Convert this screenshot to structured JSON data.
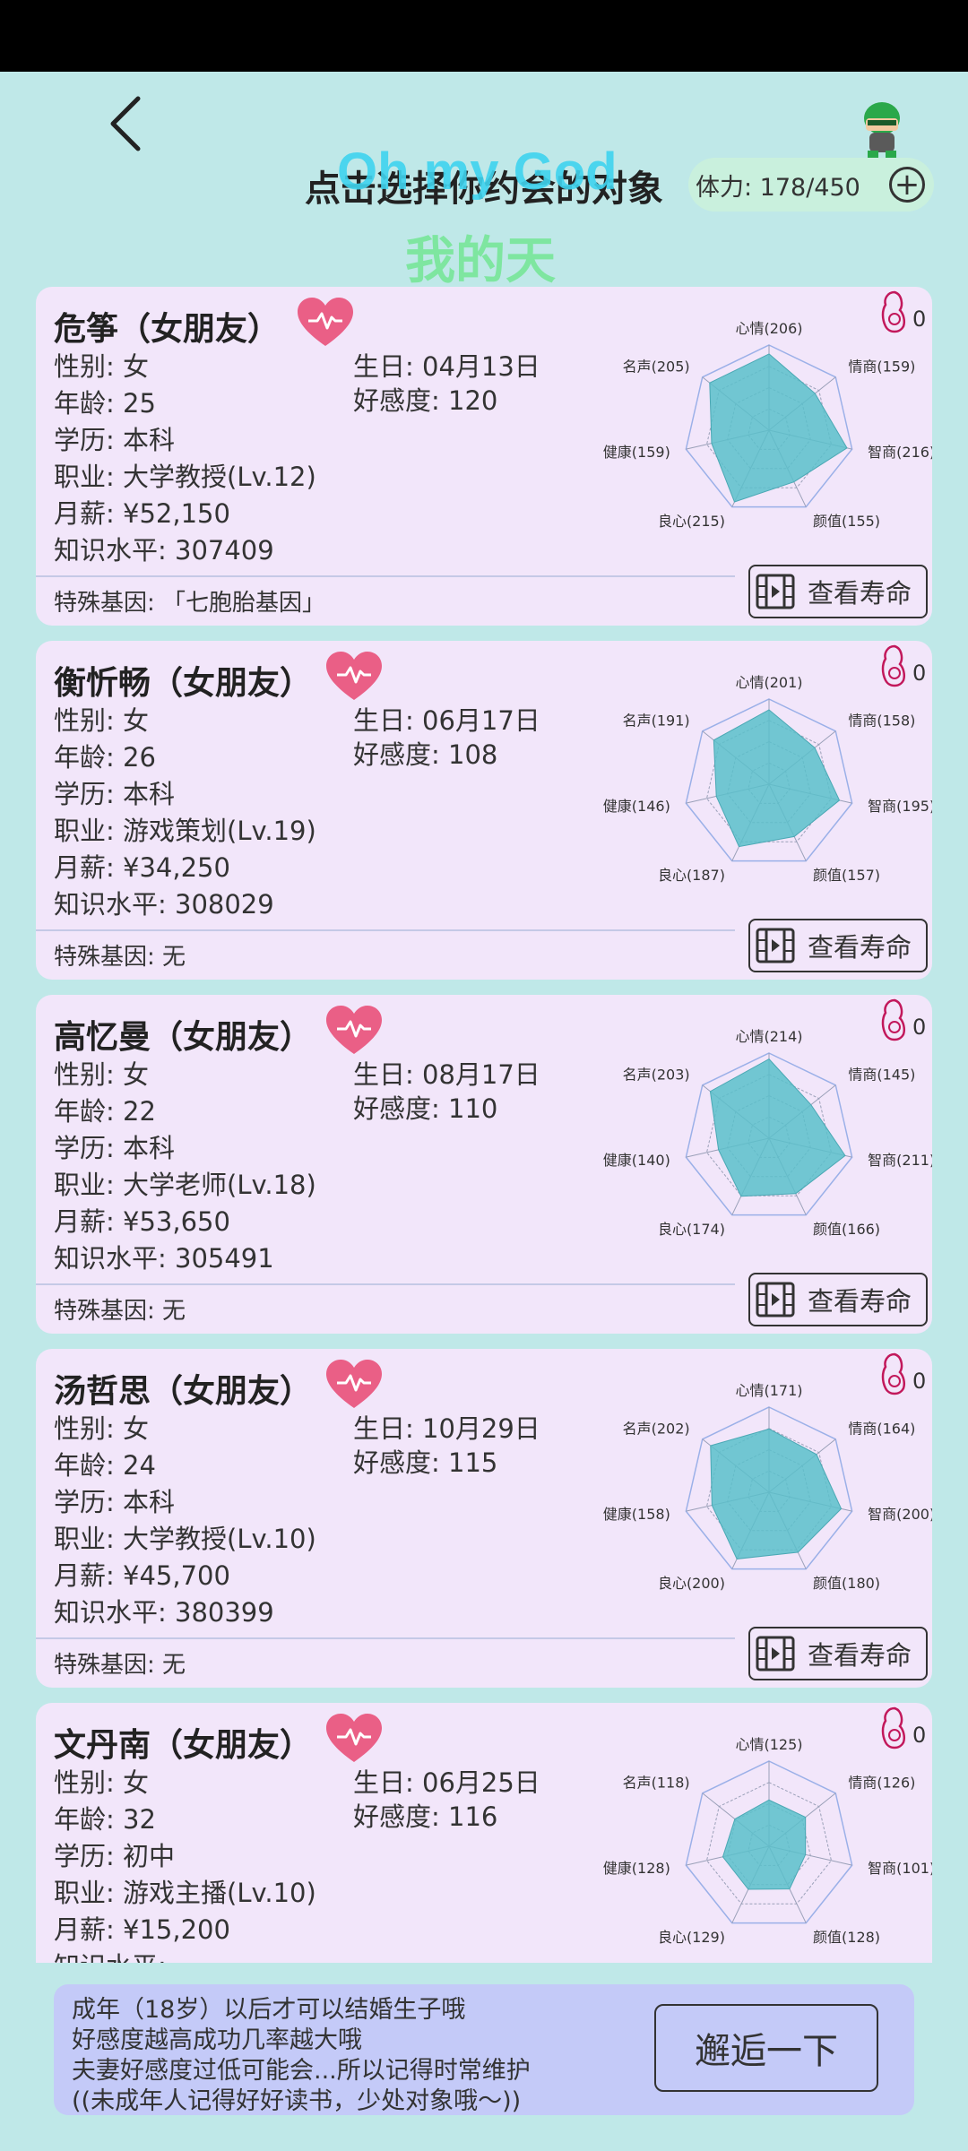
{
  "header": {
    "title": "点击选择你约会的对象",
    "overlay_en": "Oh my God",
    "overlay_zh": "我的天",
    "stamina": "体力: 178/450",
    "plus": "+"
  },
  "labels": {
    "gender": "性别: ",
    "age": "年龄: ",
    "edu": "学历: ",
    "job": "职业: ",
    "salary": "月薪: ",
    "knowledge": "知识水平: ",
    "birthday": "生日: ",
    "affinity": "好感度: ",
    "gene": "特殊基因: ",
    "life_button": "查看寿命",
    "radar_axes": [
      "心情",
      "情商",
      "智商",
      "颜值",
      "良心",
      "健康",
      "名声"
    ]
  },
  "characters": [
    {
      "name": "危筝（女朋友）",
      "gender": "女",
      "age": "25",
      "education": "本科",
      "job": "大学教授(Lv.12)",
      "salary": "¥52,150",
      "knowledge": "307409",
      "birthday": "04月13日",
      "affinity": "120",
      "gene": "「七胞胎基因」",
      "baby_count": "0",
      "stats": [
        206,
        159,
        216,
        155,
        215,
        159,
        205
      ]
    },
    {
      "name": "衡忻畅（女朋友）",
      "gender": "女",
      "age": "26",
      "education": "本科",
      "job": "游戏策划(Lv.19)",
      "salary": "¥34,250",
      "knowledge": "308029",
      "birthday": "06月17日",
      "affinity": "108",
      "gene": "无",
      "baby_count": "0",
      "stats": [
        201,
        158,
        195,
        157,
        187,
        146,
        191
      ]
    },
    {
      "name": "高忆曼（女朋友）",
      "gender": "女",
      "age": "22",
      "education": "本科",
      "job": "大学老师(Lv.18)",
      "salary": "¥53,650",
      "knowledge": "305491",
      "birthday": "08月17日",
      "affinity": "110",
      "gene": "无",
      "baby_count": "0",
      "stats": [
        214,
        145,
        211,
        166,
        174,
        140,
        203
      ]
    },
    {
      "name": "汤哲思（女朋友）",
      "gender": "女",
      "age": "24",
      "education": "本科",
      "job": "大学教授(Lv.10)",
      "salary": "¥45,700",
      "knowledge": "380399",
      "birthday": "10月29日",
      "affinity": "115",
      "gene": "无",
      "baby_count": "0",
      "stats": [
        171,
        164,
        200,
        180,
        200,
        158,
        202
      ]
    },
    {
      "name": "文丹南（女朋友）",
      "gender": "女",
      "age": "32",
      "education": "初中",
      "job": "游戏主播(Lv.10)",
      "salary": "¥15,200",
      "knowledge": "",
      "birthday": "06月25日",
      "affinity": "116",
      "gene": "",
      "baby_count": "0",
      "stats": [
        125,
        126,
        101,
        128,
        129,
        128,
        118
      ]
    }
  ],
  "footer": {
    "tips": [
      "成年（18岁）以后才可以结婚生子哦",
      "好感度越高成功几率越大哦",
      "夫妻好感度过低可能会...所以记得时常维护",
      "((未成年人记得好好读书，少处对象哦～))"
    ],
    "button": "邂逅一下"
  },
  "colors": {
    "background": "#bfe8e8",
    "card": "#f2e6fa",
    "radar_fill": "#5bbfca",
    "heart": "#ea5f86",
    "footer": "#c4caf8",
    "stamina_pill": "#c9f0dd"
  }
}
